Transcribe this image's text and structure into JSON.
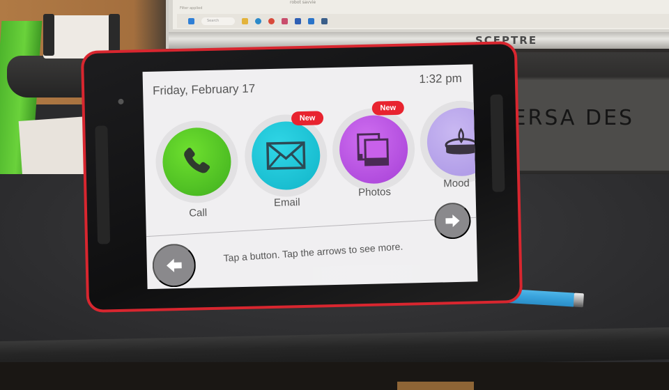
{
  "scene": {
    "monitor": {
      "brand": "SCEPTRE",
      "caption": "robot savvie",
      "filter_text": "Filter applied",
      "taskbar_search": "Search",
      "taskbar_icons": [
        {
          "name": "windows-start-icon",
          "color": "#2f7fd6"
        },
        {
          "name": "file-explorer-icon",
          "color": "#e3b33b"
        },
        {
          "name": "edge-browser-icon",
          "color": "#2c8ac9"
        },
        {
          "name": "chrome-browser-icon",
          "color": "#d84a3a"
        },
        {
          "name": "slack-icon",
          "color": "#c94d6c"
        },
        {
          "name": "word-icon",
          "color": "#2f5fb4"
        },
        {
          "name": "outlook-icon",
          "color": "#2a74c9"
        },
        {
          "name": "photos-app-icon",
          "color": "#3b5f8a"
        }
      ]
    },
    "desk_brand": "VERSA DES"
  },
  "tablet": {
    "header": {
      "date": "Friday, February 17",
      "time": "1:32 pm"
    },
    "apps": [
      {
        "id": "call",
        "label": "Call",
        "color": "#4ec425",
        "icon": "phone-icon",
        "badge": null
      },
      {
        "id": "email",
        "label": "Email",
        "color": "#16c0d3",
        "icon": "envelope-icon",
        "badge": "New"
      },
      {
        "id": "photos",
        "label": "Photos",
        "color": "#b64fe0",
        "icon": "photos-stack-icon",
        "badge": "New"
      },
      {
        "id": "mood",
        "label": "Mood",
        "color": "#b9a6ec",
        "icon": "candle-icon",
        "badge": null
      }
    ],
    "hint": "Tap a button. Tap the arrows to see more.",
    "nav": {
      "prev_icon": "arrow-left-icon",
      "next_icon": "arrow-right-icon"
    },
    "colors": {
      "case": "#d8262f",
      "badge": "#e8232f",
      "nav_button": "#8a898c",
      "screen_bg": "#f0eff1"
    }
  }
}
